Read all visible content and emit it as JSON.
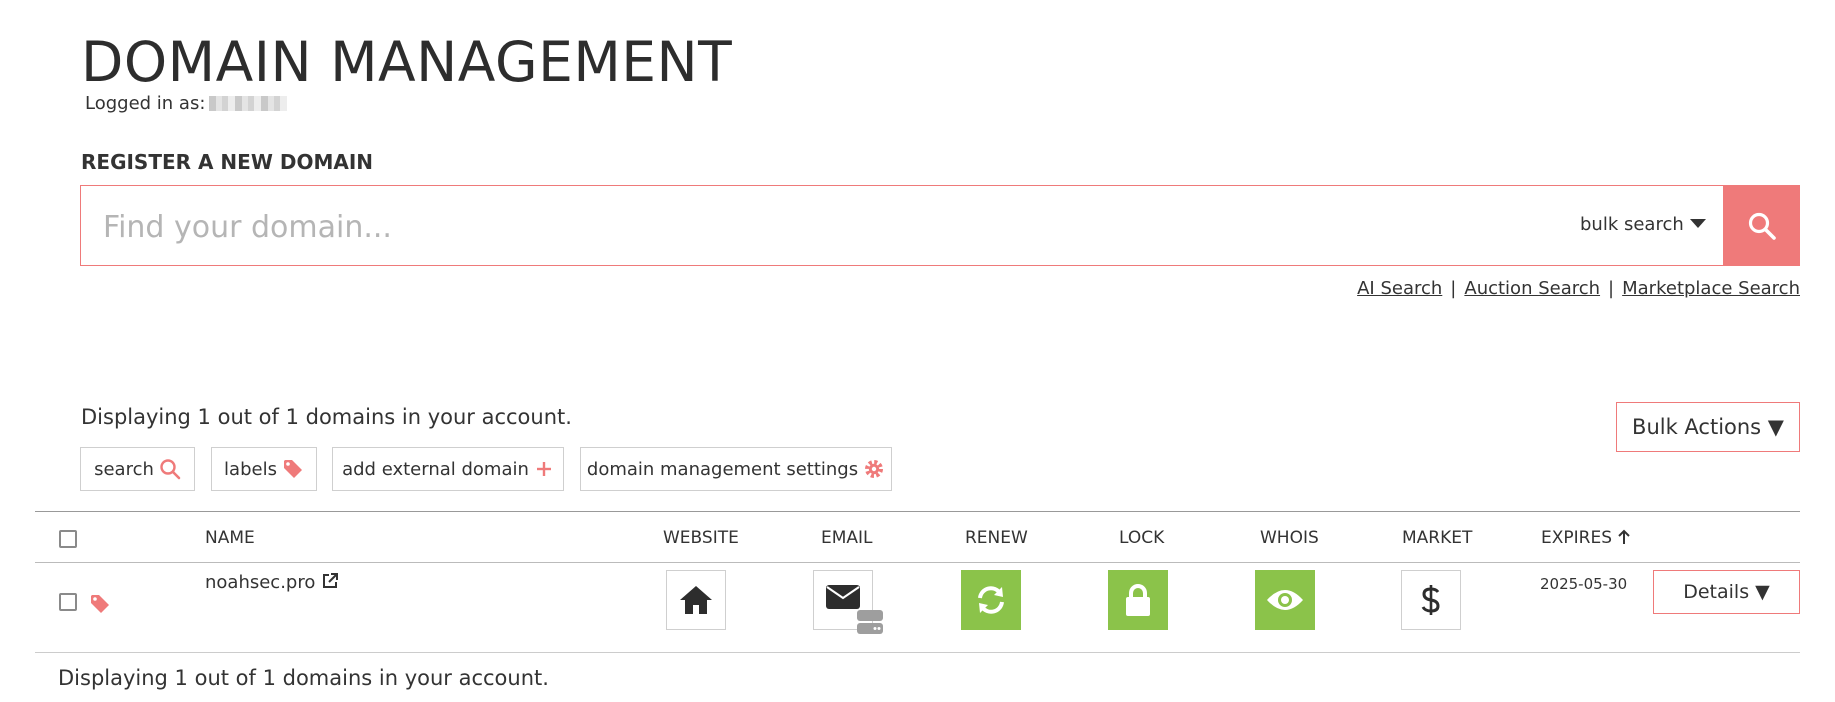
{
  "header": {
    "title": "DOMAIN MANAGEMENT",
    "logged_in_label": "Logged in as:"
  },
  "register": {
    "heading": "REGISTER A NEW DOMAIN",
    "placeholder": "Find your domain...",
    "bulk_search_label": "bulk search",
    "search_icon": "search-icon"
  },
  "search_links": {
    "ai_search": "AI Search",
    "auction_search": "Auction Search",
    "marketplace_search": "Marketplace Search",
    "separator": "|"
  },
  "summary": {
    "display_text": "Displaying 1 out of 1 domains in your account."
  },
  "bulk_actions": {
    "label": "Bulk Actions ▼"
  },
  "toolbar": {
    "search_label": "search",
    "labels_label": "labels",
    "add_external_label": "add external domain",
    "settings_label": "domain management settings"
  },
  "table": {
    "columns": {
      "name": "NAME",
      "website": "WEBSITE",
      "email": "EMAIL",
      "renew": "RENEW",
      "lock": "LOCK",
      "whois": "WHOIS",
      "market": "MARKET",
      "expires": "EXPIRES"
    },
    "rows": [
      {
        "name": "noahsec.pro",
        "expires": "2025-05-30",
        "details_label": "Details ▼",
        "icons": {
          "website": "home-icon",
          "email": "envelope-icon",
          "renew": "refresh-icon",
          "lock": "lock-icon",
          "whois": "eye-icon",
          "market": "dollar-icon"
        }
      }
    ]
  },
  "colors": {
    "accent": "#ef7a7a",
    "green": "#8bc34a",
    "text": "#333333"
  }
}
